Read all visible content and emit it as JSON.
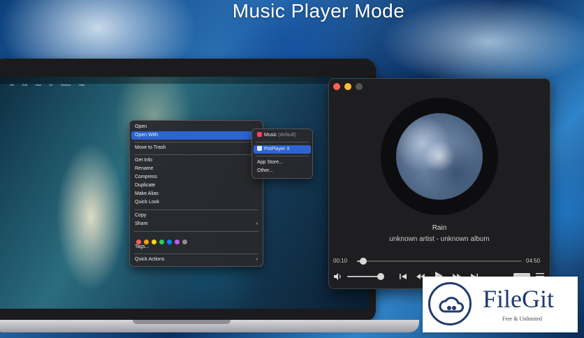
{
  "headline": "Music Player Mode",
  "laptop": {
    "menubar_items": [
      "",
      "File",
      "Edit",
      "View",
      "Go",
      "Window",
      "Help"
    ]
  },
  "context_menu": {
    "items": [
      {
        "label": "Open",
        "selected": false,
        "has_submenu": false
      },
      {
        "label": "Open With",
        "selected": true,
        "has_submenu": true
      },
      {
        "label": "Move to Trash",
        "selected": false,
        "has_submenu": false
      },
      {
        "label": "Get Info",
        "selected": false,
        "has_submenu": false
      },
      {
        "label": "Rename",
        "selected": false,
        "has_submenu": false
      },
      {
        "label": "Compress",
        "selected": false,
        "has_submenu": false
      },
      {
        "label": "Duplicate",
        "selected": false,
        "has_submenu": false
      },
      {
        "label": "Make Alias",
        "selected": false,
        "has_submenu": false
      },
      {
        "label": "Quick Look",
        "selected": false,
        "has_submenu": false
      },
      {
        "label": "Copy",
        "selected": false,
        "has_submenu": false
      },
      {
        "label": "Share",
        "selected": false,
        "has_submenu": true
      },
      {
        "label": "Tags...",
        "selected": false,
        "has_submenu": false
      },
      {
        "label": "Quick Actions",
        "selected": false,
        "has_submenu": true
      }
    ],
    "tag_colors": [
      "#ff5f57",
      "#ff9f0a",
      "#ffd60a",
      "#30d158",
      "#0a84ff",
      "#bf5af2",
      "#8e8e93"
    ]
  },
  "open_with_submenu": {
    "music": "Music",
    "music_default": "(default)",
    "potplayer": "PotPlayer X",
    "app_store": "App Store...",
    "other": "Other..."
  },
  "player": {
    "song_title": "Rain",
    "song_subtitle": "unknown artist - unknown album",
    "elapsed": "00:10",
    "duration": "04:50",
    "progress": 0.04,
    "volume": 1.0
  },
  "watermark": {
    "name": "FileGit",
    "tagline": "Free & Unlimited"
  },
  "colors": {
    "accent": "#2d64d2",
    "close": "#ff5f57",
    "minimize": "#febc2e",
    "zoom": "#555555",
    "brand": "#1f3a6b"
  }
}
